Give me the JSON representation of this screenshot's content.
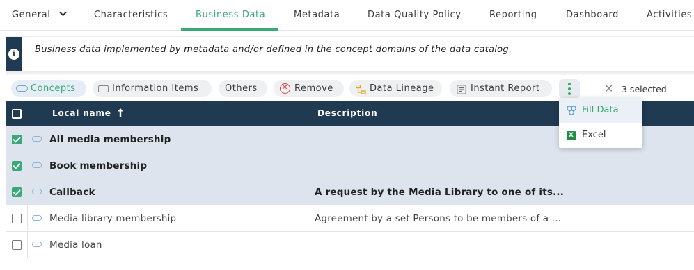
{
  "tabs": [
    {
      "label": "General"
    },
    {
      "label": "Characteristics"
    },
    {
      "label": "Business Data",
      "active": true
    },
    {
      "label": "Metadata"
    },
    {
      "label": "Data Quality Policy"
    },
    {
      "label": "Reporting"
    },
    {
      "label": "Dashboard"
    },
    {
      "label": "Activities"
    }
  ],
  "info": {
    "icon": "info-icon",
    "text": "Business data implemented by metadata and/or defined in the concept domains of the data catalog."
  },
  "toolbar": {
    "concepts": "Concepts",
    "information_items": "Information Items",
    "others": "Others",
    "remove": "Remove",
    "data_lineage": "Data Lineage",
    "instant_report": "Instant Report",
    "selected_count": "3 selected"
  },
  "table": {
    "columns": {
      "name": "Local name",
      "description": "Description"
    },
    "rows": [
      {
        "name": "All media membership",
        "description": "",
        "checked": true
      },
      {
        "name": "Book membership",
        "description": "",
        "checked": true
      },
      {
        "name": "Callback",
        "description": "A request by the Media Library to one of its...",
        "checked": true
      },
      {
        "name": "Media library membership",
        "description": "Agreement by a set Persons to be members of a ...",
        "checked": false
      },
      {
        "name": "Media loan",
        "description": "",
        "checked": false
      }
    ]
  },
  "menu": {
    "fill_data": "Fill Data",
    "excel": "Excel",
    "excel_icon_letter": "X"
  },
  "colors": {
    "accent": "#3aa877",
    "header_bg": "#203a52",
    "selected_row_bg": "#dde4ed",
    "remove": "#d43f3f"
  }
}
